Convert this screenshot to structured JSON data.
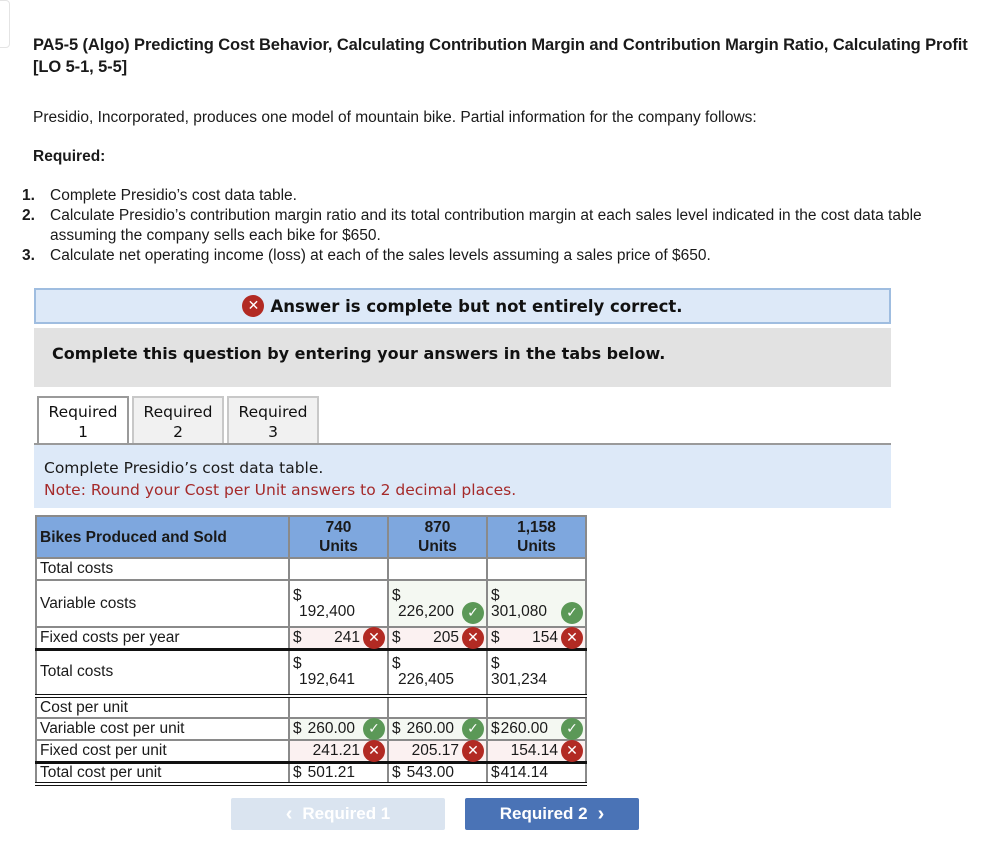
{
  "page": {
    "title": "PA5-5 (Algo) Predicting Cost Behavior, Calculating Contribution Margin and Contribution Margin Ratio, Calculating Profit [LO 5-1, 5-5]",
    "intro": "Presidio, Incorporated, produces one model of mountain bike. Partial information for the company follows:",
    "required_heading": "Required:",
    "requirements": [
      {
        "num": "1.",
        "text": "Complete Presidio’s cost data table."
      },
      {
        "num": "2.",
        "text": "Calculate Presidio’s contribution margin ratio and its total contribution margin at each sales level indicated in the cost data table assuming the company sells each bike for $650."
      },
      {
        "num": "3.",
        "text": "Calculate net operating income (loss) at each of the sales levels assuming a sales price of $650."
      }
    ]
  },
  "banner": {
    "icon": "error-x-icon",
    "text": "Answer is complete but not entirely correct.",
    "color": "#b22a23"
  },
  "instruction": "Complete this question by entering your answers in the tabs below.",
  "tabs": [
    {
      "line1": "Required",
      "line2": "1",
      "active": true
    },
    {
      "line1": "Required",
      "line2": "2",
      "active": false
    },
    {
      "line1": "Required",
      "line2": "3",
      "active": false
    }
  ],
  "panel": {
    "prompt": "Complete Presidio’s cost data table.",
    "note": "Note: Round your Cost per Unit answers to 2 decimal places."
  },
  "table": {
    "header": {
      "label": "Bikes Produced and Sold",
      "columns": [
        {
          "qty": "740",
          "unit": "Units"
        },
        {
          "qty": "870",
          "unit": "Units"
        },
        {
          "qty": "1,158",
          "unit": "Units"
        }
      ]
    },
    "rows": {
      "total_costs_section": "Total costs",
      "variable_costs": {
        "label": "Variable costs",
        "cells": [
          {
            "currency": "$",
            "value": "192,400",
            "status": "none"
          },
          {
            "currency": "$",
            "value": "226,200",
            "status": "correct"
          },
          {
            "currency": "$",
            "value": "301,080",
            "status": "correct"
          }
        ]
      },
      "fixed_costs": {
        "label": "Fixed costs per year",
        "cells": [
          {
            "currency": "$",
            "value": "241",
            "status": "incorrect"
          },
          {
            "currency": "$",
            "value": "205",
            "status": "incorrect"
          },
          {
            "currency": "$",
            "value": "154",
            "status": "incorrect"
          }
        ]
      },
      "total_costs": {
        "label": "Total costs",
        "cells": [
          {
            "currency": "$",
            "value": "192,641"
          },
          {
            "currency": "$",
            "value": "226,405"
          },
          {
            "currency": "$",
            "value": "301,234"
          }
        ]
      },
      "cost_per_unit_section": "Cost per unit",
      "variable_cost_per_unit": {
        "label": "Variable cost per unit",
        "cells": [
          {
            "currency": "$",
            "value": "260.00",
            "status": "correct"
          },
          {
            "currency": "$",
            "value": "260.00",
            "status": "correct"
          },
          {
            "currency": "$",
            "value": "260.00",
            "status": "correct"
          }
        ]
      },
      "fixed_cost_per_unit": {
        "label": "Fixed cost per unit",
        "cells": [
          {
            "value": "241.21",
            "status": "incorrect"
          },
          {
            "value": "205.17",
            "status": "incorrect"
          },
          {
            "value": "154.14",
            "status": "incorrect"
          }
        ]
      },
      "total_cost_per_unit": {
        "label": "Total cost per unit",
        "cells": [
          {
            "currency": "$",
            "value": "501.21"
          },
          {
            "currency": "$",
            "value": "543.00"
          },
          {
            "currency": "$",
            "value": "414.14"
          }
        ]
      }
    },
    "status_colors": {
      "correct": "#5b9857",
      "incorrect": "#b22a23"
    }
  },
  "nav": {
    "prev_label": "Required 1",
    "next_label": "Required 2",
    "prev_icon": "‹",
    "next_icon": "›"
  },
  "icons": {
    "check": "✓",
    "cross": "✕"
  }
}
